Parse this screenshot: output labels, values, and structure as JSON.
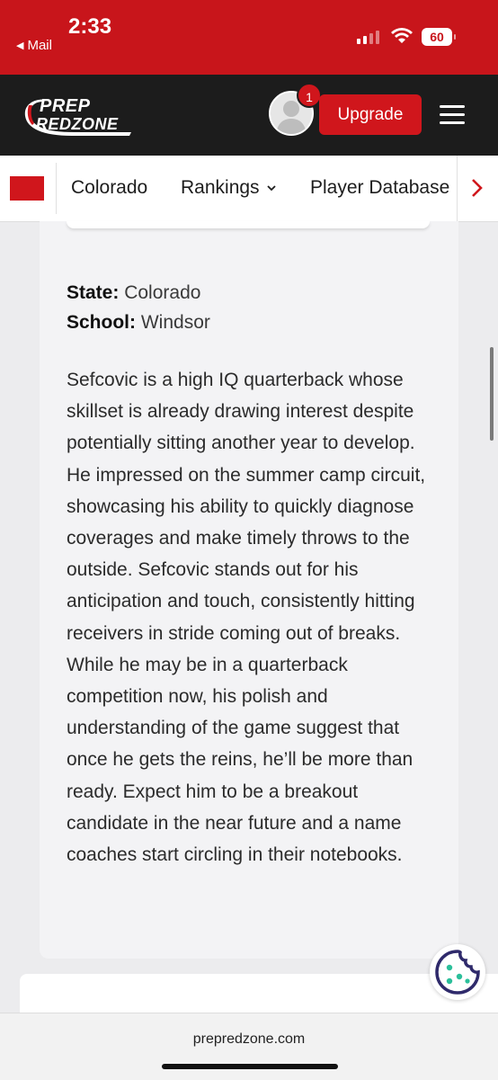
{
  "status_bar": {
    "time": "2:33",
    "back_app": "Mail",
    "battery": "60"
  },
  "header": {
    "logo_line1": "PREP",
    "logo_line2": "REDZONE",
    "notification_count": "1",
    "upgrade_label": "Upgrade"
  },
  "nav": {
    "state": "Colorado",
    "rankings": "Rankings",
    "player_database": "Player Database"
  },
  "profile": {
    "state_label": "State:",
    "state_value": "Colorado",
    "school_label": "School:",
    "school_value": "Windsor",
    "bio": "Sefcovic is a high IQ quarterback whose skillset is already drawing interest despite potentially sitting another year to develop. He impressed on the summer camp circuit, showcasing his ability to quickly diagnose coverages and make timely throws to the outside. Sefcovic stands out for his anticipation and touch, consistently hitting receivers in stride coming out of breaks. While he may be in a quarterback competition now, his polish and understanding of the game suggest that once he gets the reins, he’ll be more than ready. Expect him to be a breakout candidate in the near future and a name coaches start circling in their notebooks."
  },
  "browser": {
    "url": "prepredzone.com"
  },
  "colors": {
    "brand_red": "#c8151b",
    "header_dark": "#1c1c1c",
    "cookie_icon": "#2f2a6b",
    "cookie_dots": "#2bbf9a"
  }
}
